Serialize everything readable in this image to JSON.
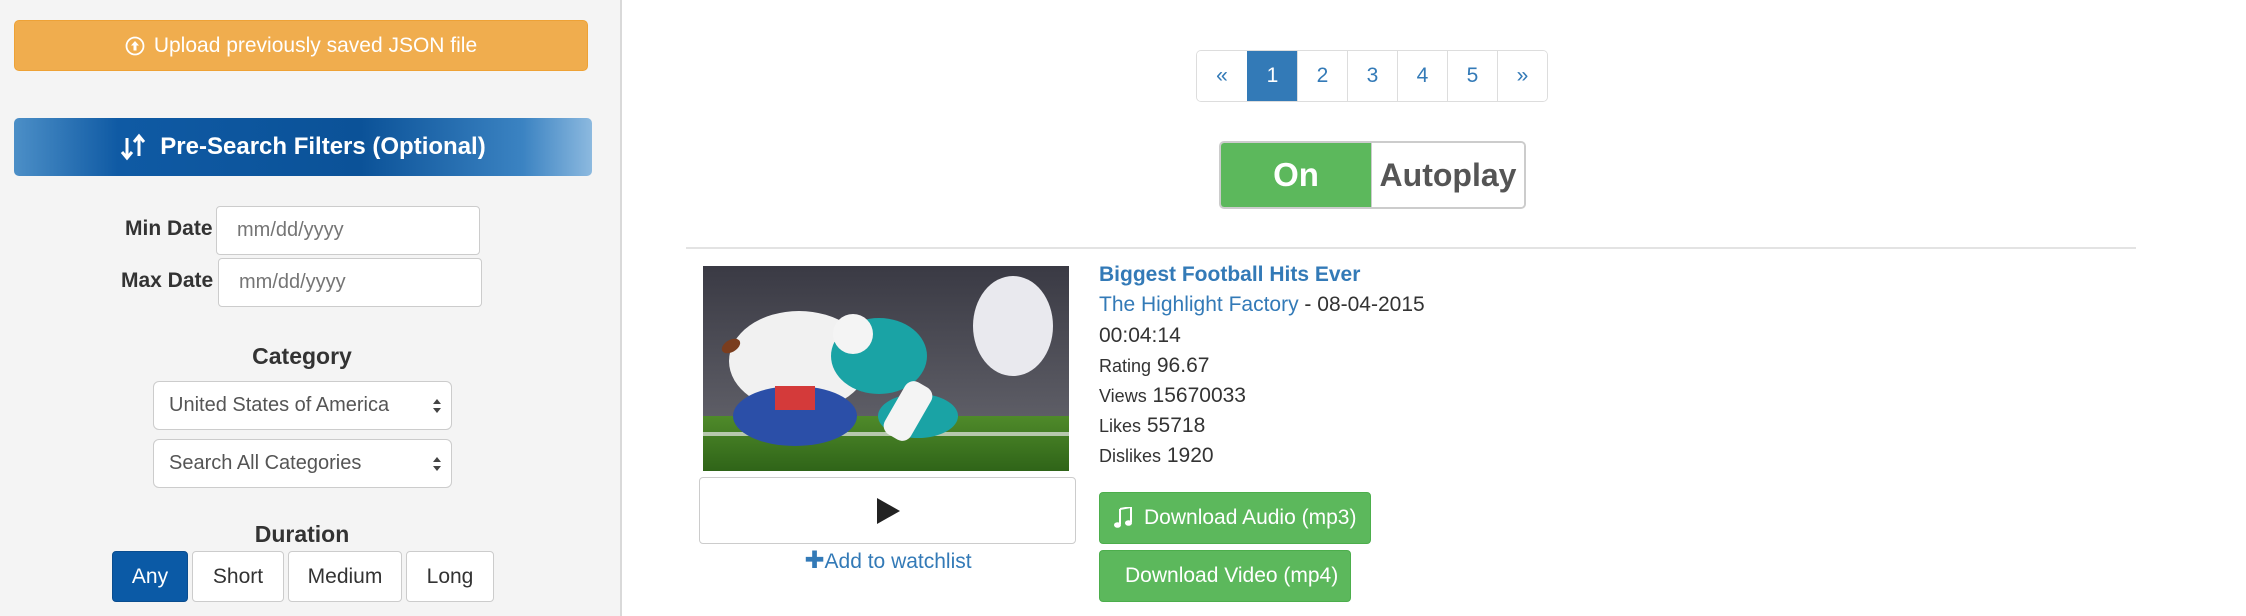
{
  "sidebar": {
    "upload_label": "Upload previously saved JSON file",
    "filters_title": "Pre-Search Filters (Optional)",
    "min_date_label": "Min Date",
    "max_date_label": "Max Date",
    "date_placeholder": "mm/dd/yyyy",
    "category_title": "Category",
    "region_selected": "United States of America",
    "category_selected": "Search All Categories",
    "duration_title": "Duration",
    "duration_options": [
      "Any",
      "Short",
      "Medium",
      "Long"
    ],
    "duration_active": "Any"
  },
  "pagination": {
    "prev": "«",
    "pages": [
      "1",
      "2",
      "3",
      "4",
      "5"
    ],
    "next": "»",
    "active": "1"
  },
  "autoplay": {
    "state": "On",
    "label": "Autoplay"
  },
  "video": {
    "title": "Biggest Football Hits Ever",
    "channel": "The Highlight Factory",
    "separator": " - ",
    "date": "08-04-2015",
    "duration": "00:04:14",
    "rating_label": "Rating",
    "rating": "96.67",
    "views_label": "Views",
    "views": "15670033",
    "likes_label": "Likes",
    "likes": "55718",
    "dislikes_label": "Dislikes",
    "dislikes": "1920",
    "watchlist_label": "Add to watchlist",
    "download_audio_label": "Download Audio (mp3)",
    "download_video_label": "Download Video (mp4)"
  },
  "colors": {
    "upload": "#f0ad4e",
    "header_blue": "#0b5298",
    "link": "#337ab7",
    "success": "#5cb85c"
  },
  "icons": {
    "upload": "circle-arrow-up-icon",
    "filters": "sort-arrows-icon",
    "play": "play-icon",
    "audio": "music-note-icon"
  }
}
